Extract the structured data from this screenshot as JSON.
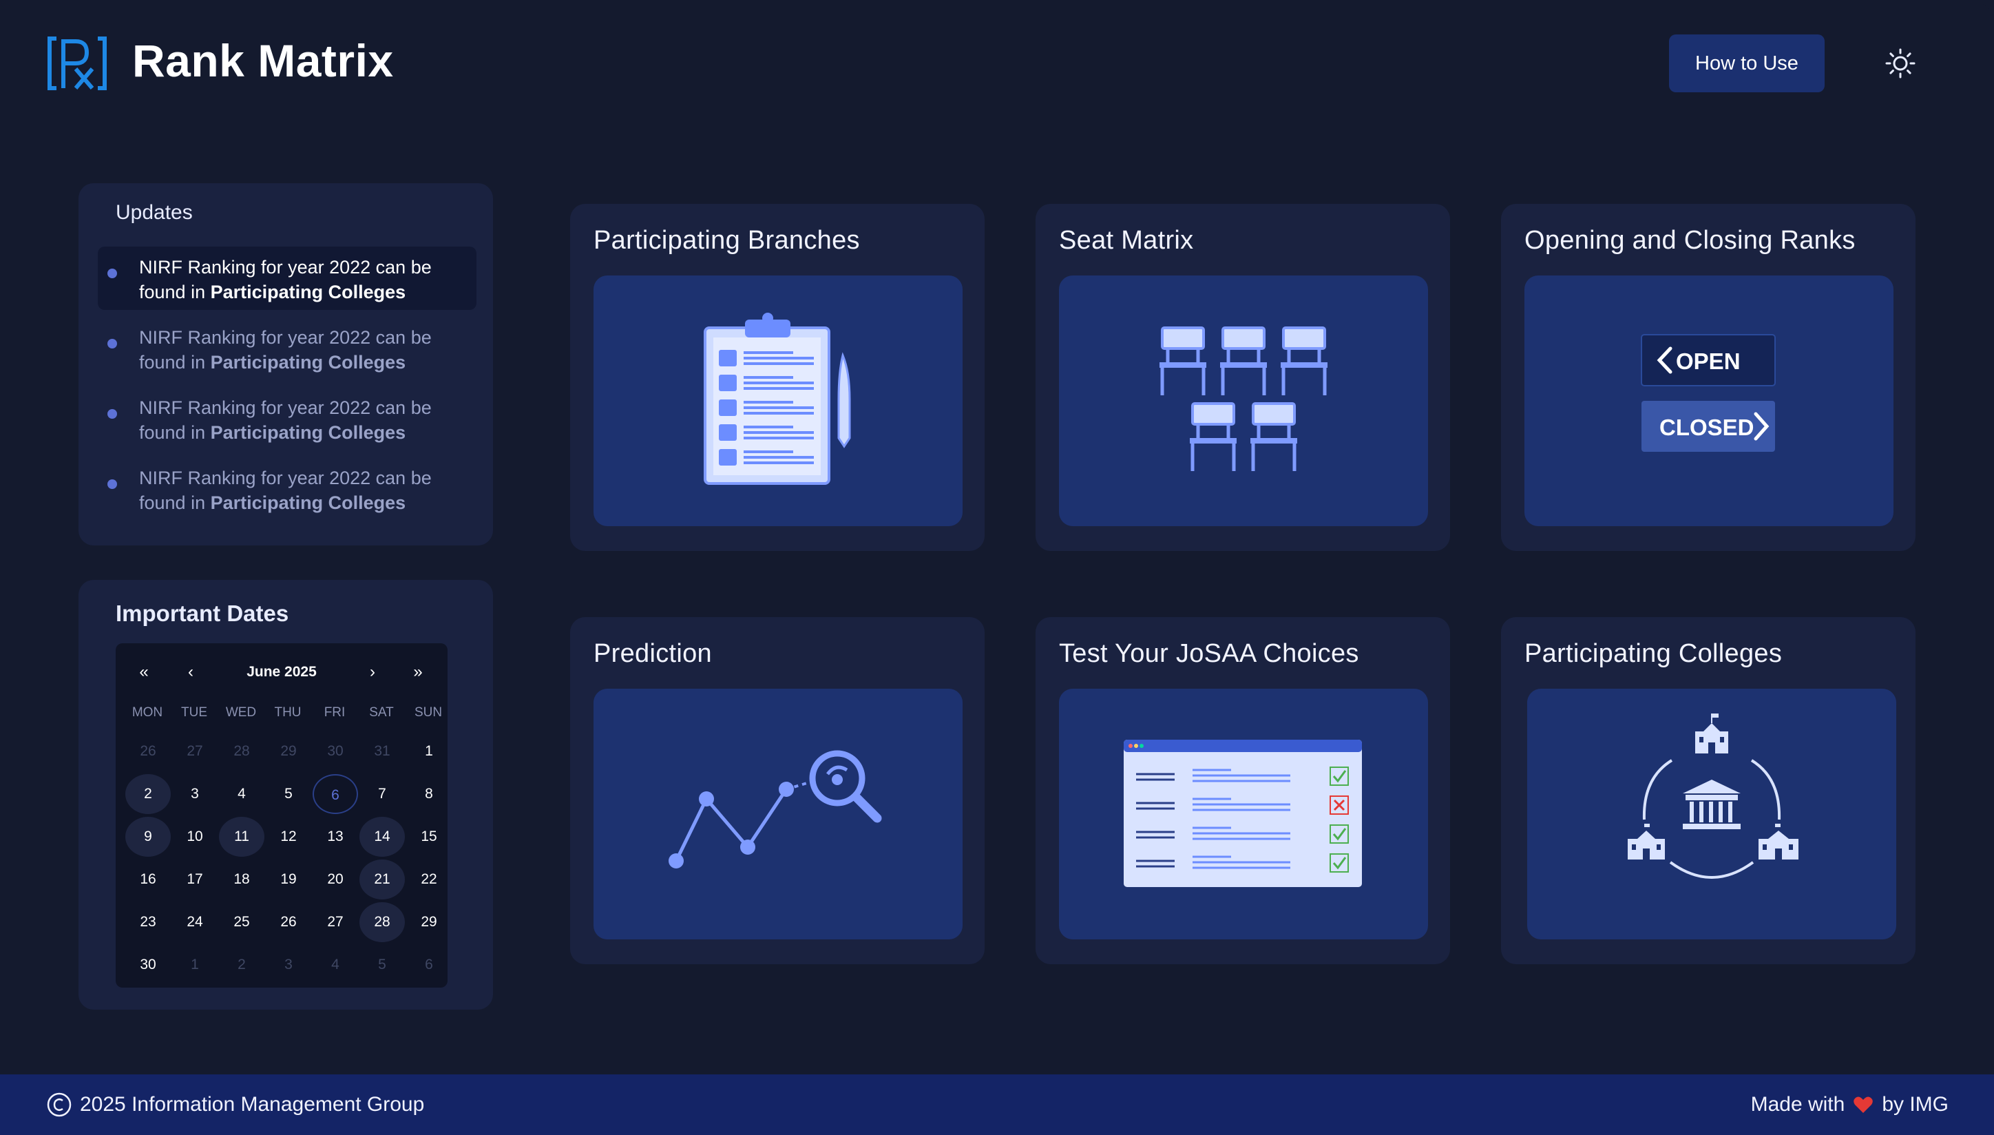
{
  "header": {
    "brand": "Rank Matrix",
    "how_to_use_label": "How to Use",
    "logo_icon": "rx-logo-icon",
    "theme_icon": "sun-icon"
  },
  "updates": {
    "title": "Updates",
    "items": [
      {
        "text_prefix": "NIRF Ranking for year 2022 can be found in ",
        "link_text": "Participating Colleges"
      },
      {
        "text_prefix": "NIRF Ranking for year 2022 can be found in ",
        "link_text": "Participating Colleges"
      },
      {
        "text_prefix": "NIRF Ranking for year 2022 can be found in ",
        "link_text": "Participating Colleges"
      },
      {
        "text_prefix": "NIRF Ranking for year 2022 can be found in ",
        "link_text": "Participating Colleges"
      }
    ]
  },
  "important_dates": {
    "title": "Important Dates",
    "nav": {
      "prev_year": "«",
      "prev_month": "‹",
      "next_month": "›",
      "next_year": "»"
    },
    "month_label": "June 2025",
    "weekdays": [
      "MON",
      "TUE",
      "WED",
      "THU",
      "FRI",
      "SAT",
      "SUN"
    ],
    "weeks": [
      [
        "26",
        "27",
        "28",
        "29",
        "30",
        "31",
        "1"
      ],
      [
        "2",
        "3",
        "4",
        "5",
        "6",
        "7",
        "8"
      ],
      [
        "9",
        "10",
        "11",
        "12",
        "13",
        "14",
        "15"
      ],
      [
        "16",
        "17",
        "18",
        "19",
        "20",
        "21",
        "22"
      ],
      [
        "23",
        "24",
        "25",
        "26",
        "27",
        "28",
        "29"
      ],
      [
        "30",
        "1",
        "2",
        "3",
        "4",
        "5",
        "6"
      ]
    ],
    "muted": [
      [
        0,
        0
      ],
      [
        0,
        1
      ],
      [
        0,
        2
      ],
      [
        0,
        3
      ],
      [
        0,
        4
      ],
      [
        0,
        5
      ],
      [
        5,
        1
      ],
      [
        5,
        2
      ],
      [
        5,
        3
      ],
      [
        5,
        4
      ],
      [
        5,
        5
      ],
      [
        5,
        6
      ]
    ],
    "highlighted": [
      [
        1,
        0
      ],
      [
        2,
        0
      ],
      [
        2,
        2
      ],
      [
        2,
        5
      ],
      [
        3,
        5
      ],
      [
        4,
        5
      ]
    ],
    "today": [
      1,
      4
    ]
  },
  "cards": {
    "branches": {
      "title": "Participating Branches",
      "icon": "clipboard-icon"
    },
    "seat_matrix": {
      "title": "Seat Matrix",
      "icon": "chairs-icon"
    },
    "ranks": {
      "title": "Opening and Closing Ranks",
      "icon": "open-closed-sign-icon",
      "open_label": "OPEN",
      "closed_label": "CLOSED"
    },
    "prediction": {
      "title": "Prediction",
      "icon": "chart-search-icon"
    },
    "josaa": {
      "title": "Test Your JoSAA Choices",
      "icon": "checklist-window-icon"
    },
    "colleges": {
      "title": "Participating Colleges",
      "icon": "college-buildings-icon"
    }
  },
  "footer": {
    "copyright": "2025 Information Management Group",
    "made_with": "Made with",
    "by": "by IMG"
  },
  "colors": {
    "background": "#141a2e",
    "panel": "#1a2240",
    "illustration_bg": "#1d3270",
    "accent": "#5d72d6",
    "logo_blue": "#1e88e5",
    "footer": "#142466",
    "heart": "#e53935"
  }
}
